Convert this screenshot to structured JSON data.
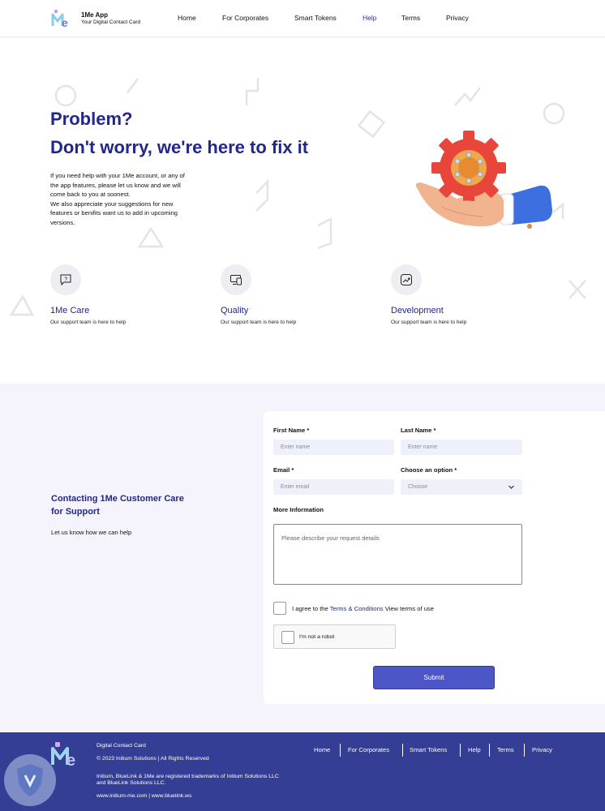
{
  "header": {
    "brand_name": "1Me App",
    "brand_tagline": "Your Digital Contact Card",
    "nav": [
      {
        "label": "Home",
        "active": false
      },
      {
        "label": "For Corporates",
        "active": false
      },
      {
        "label": "Smart Tokens",
        "active": false
      },
      {
        "label": "Help",
        "active": true
      },
      {
        "label": "Terms",
        "active": false
      },
      {
        "label": "Privacy",
        "active": false
      }
    ]
  },
  "hero": {
    "title_line1": "Problem?",
    "title_line2": "Don't worry, we're here to fix it",
    "description_lines": [
      "If you need help with your 1Me account, or any of",
      "the app features, please let us know and we will",
      "come back to you at soonest.",
      "We also appreciate your suggestions for new",
      "features or benifits want us to add in upcoming",
      "versions."
    ]
  },
  "features": [
    {
      "title": "1Me Care",
      "subtitle": "Our support team is here to help",
      "icon": "chat-question-icon"
    },
    {
      "title": "Quality",
      "subtitle": "Our support team is here to help",
      "icon": "devices-icon"
    },
    {
      "title": "Development",
      "subtitle": "Our support team is here to help",
      "icon": "trend-chart-icon"
    }
  ],
  "contact": {
    "heading": "Contacting 1Me Customer Care for Support",
    "subtext": "Let us know how we can help"
  },
  "form": {
    "first_name_label": "First Name *",
    "first_name_placeholder": "Enter name",
    "last_name_label": "Last Name *",
    "last_name_placeholder": "Enter name",
    "email_label": "Email *",
    "email_placeholder": "Enter email",
    "option_label": "Choose an option *",
    "option_value": "Choose",
    "more_info_label": "More Information",
    "more_info_placeholder": "Please describe your request details",
    "agree_prefix": "I agree to the",
    "agree_link": "Terms & Conditions",
    "agree_suffix": "View terms of use",
    "captcha_label": "I'm not a robot",
    "submit_label": "Submit"
  },
  "footer": {
    "title": "Digital Contact Card",
    "copyright": "© 2023 Initium Solutions | All Rights Reserved",
    "trademark_line1": "Initium, BlueLink & 1Me are registered trademarks of Initium Solutions LLC",
    "trademark_line2": "and BlueLink Solutions LLC.",
    "links": "www.initium-me.com | www.bluelink.ws",
    "nav": [
      "Home",
      "For Corporates",
      "Smart Tokens",
      "Help",
      "Terms",
      "Privacy"
    ]
  },
  "colors": {
    "primary": "#22278a",
    "accent_button": "#4c56c7",
    "footer_bg": "#333e94",
    "band_bg": "#f5f4fd",
    "input_bg": "#eef0fa"
  }
}
